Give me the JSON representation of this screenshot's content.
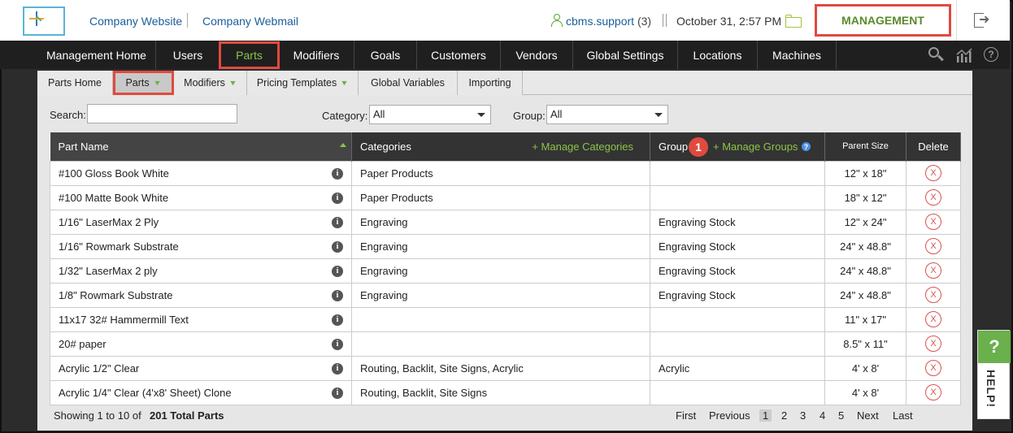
{
  "topbar": {
    "links": [
      "Company Website",
      "Company Webmail"
    ],
    "user": "cbms.support",
    "user_count": "(3)",
    "datetime": "October 31, 2:57 PM",
    "management_label": "MANAGEMENT"
  },
  "mainnav": {
    "items": [
      "Management Home",
      "Users",
      "Parts",
      "Modifiers",
      "Goals",
      "Customers",
      "Vendors",
      "Global Settings",
      "Locations",
      "Machines"
    ],
    "active": "Parts"
  },
  "subnav": {
    "items": [
      "Parts Home",
      "Parts",
      "Modifiers",
      "Pricing Templates",
      "Global Variables",
      "Importing"
    ],
    "active": "Parts"
  },
  "filters": {
    "search_label": "Search:",
    "search_value": "",
    "category_label": "Category:",
    "category_value": "All",
    "group_label": "Group:",
    "group_value": "All"
  },
  "table": {
    "headers": {
      "part_name": "Part Name",
      "categories": "Categories",
      "manage_categories": "+ Manage Categories",
      "group": "Group",
      "manage_groups": "+ Manage Groups",
      "parent_size": "Parent Size",
      "delete": "Delete"
    },
    "badge": "1",
    "rows": [
      {
        "name": "#100 Gloss Book White",
        "categories": "Paper Products",
        "group": "",
        "size": "12\" x 18\""
      },
      {
        "name": "#100 Matte Book White",
        "categories": "Paper Products",
        "group": "",
        "size": "18\" x 12\""
      },
      {
        "name": "1/16\" LaserMax 2 Ply",
        "categories": "Engraving",
        "group": "Engraving Stock",
        "size": "12\" x 24\""
      },
      {
        "name": "1/16\" Rowmark Substrate",
        "categories": "Engraving",
        "group": "Engraving Stock",
        "size": "24\" x 48.8\""
      },
      {
        "name": "1/32\" LaserMax 2 ply",
        "categories": "Engraving",
        "group": "Engraving Stock",
        "size": "24\" x 48.8\""
      },
      {
        "name": "1/8\" Rowmark Substrate",
        "categories": "Engraving",
        "group": "Engraving Stock",
        "size": "24\" x 48.8\""
      },
      {
        "name": "11x17 32# Hammermill Text",
        "categories": "",
        "group": "",
        "size": "11\" x 17\""
      },
      {
        "name": "20# paper",
        "categories": "",
        "group": "",
        "size": "8.5\" x 11\""
      },
      {
        "name": "Acrylic 1/2\" Clear",
        "categories": "Routing, Backlit, Site Signs, Acrylic",
        "group": "Acrylic",
        "size": "4' x 8'"
      },
      {
        "name": "Acrylic 1/4\" Clear (4'x8' Sheet) Clone",
        "categories": "Routing, Backlit, Site Signs",
        "group": "",
        "size": "4' x 8'"
      }
    ]
  },
  "footer": {
    "showing": "Showing 1 to 10 of",
    "total": "201 Total Parts",
    "first": "First",
    "previous": "Previous",
    "pages": [
      "1",
      "2",
      "3",
      "4",
      "5"
    ],
    "current_page": "1",
    "next": "Next",
    "last": "Last"
  },
  "help": {
    "q": "?",
    "label": "HELP!"
  }
}
